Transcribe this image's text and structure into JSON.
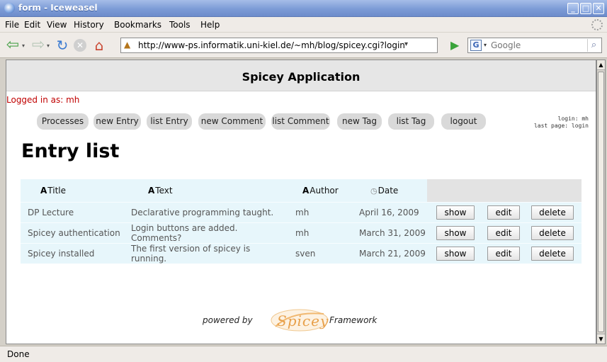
{
  "window": {
    "title": "form - Iceweasel"
  },
  "menu": {
    "items": [
      "File",
      "Edit",
      "View",
      "History",
      "Bookmarks",
      "Tools",
      "Help"
    ]
  },
  "navbar": {
    "url": "http://www-ps.informatik.uni-kiel.de/~mh/blog/spicey.cgi?login",
    "search_placeholder": "Google",
    "search_engine_letter": "G"
  },
  "page": {
    "app_title": "Spicey Application",
    "logged_in": "Logged in as: mh",
    "nav_buttons": [
      "Processes",
      "new Entry",
      "list Entry",
      "new Comment",
      "list Comment",
      "new Tag",
      "list Tag",
      "logout"
    ],
    "login_info_line1": "login: mh",
    "login_info_line2": "last page: login",
    "heading": "Entry list",
    "table": {
      "headers": [
        "Title",
        "Text",
        "Author",
        "Date"
      ],
      "rows": [
        {
          "title": "DP Lecture",
          "text": "Declarative programming taught.",
          "author": "mh",
          "date": "April 16, 2009"
        },
        {
          "title": "Spicey authentication",
          "text": "Login buttons are added. Comments?",
          "author": "mh",
          "date": "March 31, 2009"
        },
        {
          "title": "Spicey installed",
          "text": "The first version of spicey is running.",
          "author": "sven",
          "date": "March 21, 2009"
        }
      ],
      "actions": {
        "show": "show",
        "edit": "edit",
        "delete": "delete"
      }
    },
    "footer": {
      "powered_by": "powered by",
      "logo_text": "Spicey",
      "framework": "Framework"
    }
  },
  "status": {
    "text": "Done"
  },
  "colors": {
    "logged_in": "#c00000",
    "table_bg": "#e7f6fb",
    "logo": "#e8a04a"
  }
}
